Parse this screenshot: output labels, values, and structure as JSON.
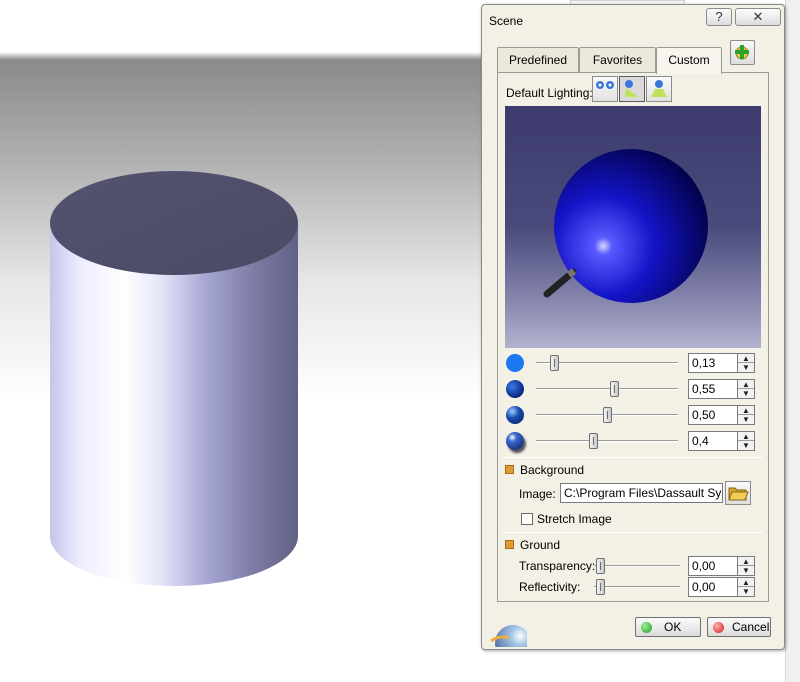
{
  "dialog": {
    "title": "Scene",
    "help_glyph": "?",
    "close_glyph": "✕"
  },
  "tabs": [
    {
      "label": "Predefined",
      "active": false
    },
    {
      "label": "Favorites",
      "active": false
    },
    {
      "label": "Custom",
      "active": true
    }
  ],
  "icons": {
    "add_favorite": "add-favorite-icon",
    "light_1": "light-two-spots-icon",
    "light_2": "light-spot-icon",
    "light_3": "light-neon-icon",
    "folder": "folder-open-icon",
    "ok": "green-dot-icon",
    "cancel": "red-dot-icon"
  },
  "lighting": {
    "label": "Default Lighting:",
    "selected_index": 1
  },
  "sliders": [
    {
      "name": "ambient",
      "value": "0,13",
      "fraction": 0.13
    },
    {
      "name": "diffuse",
      "value": "0,55",
      "fraction": 0.55
    },
    {
      "name": "specular",
      "value": "0,50",
      "fraction": 0.5
    },
    {
      "name": "shininess",
      "value": "0,4",
      "fraction": 0.4
    }
  ],
  "background": {
    "heading": "Background",
    "image_label": "Image:",
    "image_path": "C:\\Program Files\\Dassault Systèmes",
    "stretch_label": "Stretch Image",
    "stretch_checked": false
  },
  "ground": {
    "heading": "Ground",
    "transparency_label": "Transparency:",
    "transparency_value": "0,00",
    "transparency_fraction": 0.0,
    "reflectivity_label": "Reflectivity:",
    "reflectivity_value": "0,00",
    "reflectivity_fraction": 0.0
  },
  "buttons": {
    "ok": "OK",
    "cancel": "Cancel"
  },
  "colors": {
    "sphere": "#1010b8",
    "cylinder": "#c8c8f0",
    "accent": "#e09a30"
  }
}
